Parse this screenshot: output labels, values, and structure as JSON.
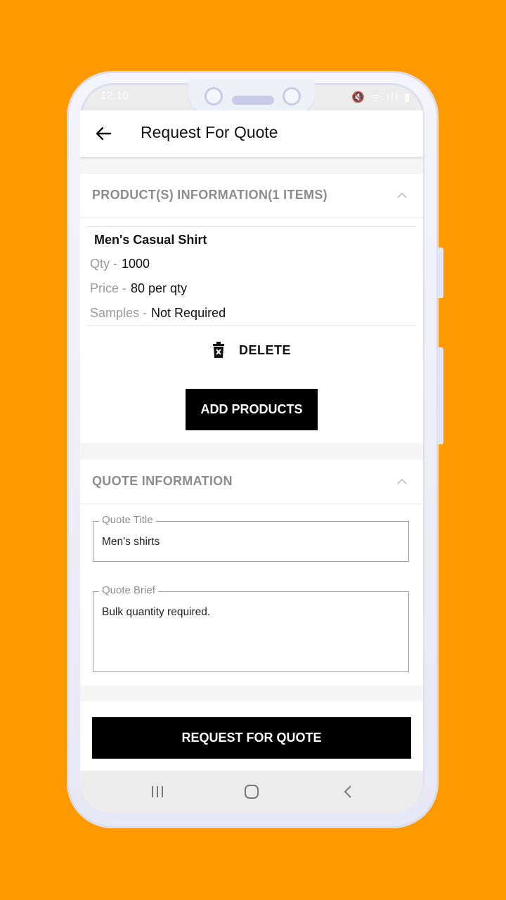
{
  "status_bar": {
    "time": "12:10",
    "icons": "🔇 ᯤ ıll ▮"
  },
  "app_bar": {
    "title": "Request For Quote"
  },
  "products_section": {
    "title": "PRODUCT(S) INFORMATION(1 ITEMS)",
    "product": {
      "name": "Men's Casual Shirt",
      "qty_label": "Qty -",
      "qty_value": "1000",
      "price_label": "Price -",
      "price_value": "80 per qty",
      "samples_label": "Samples -",
      "samples_value": "Not Required"
    },
    "delete_label": "DELETE",
    "add_products_label": "ADD PRODUCTS"
  },
  "quote_section": {
    "title": "QUOTE INFORMATION",
    "quote_title": {
      "label": "Quote Title",
      "value": "Men's shirts"
    },
    "quote_brief": {
      "label": "Quote Brief",
      "value": "Bulk quantity required."
    }
  },
  "submit_label": "REQUEST FOR QUOTE",
  "colors": {
    "background": "#FF9900",
    "button": "#000000"
  }
}
